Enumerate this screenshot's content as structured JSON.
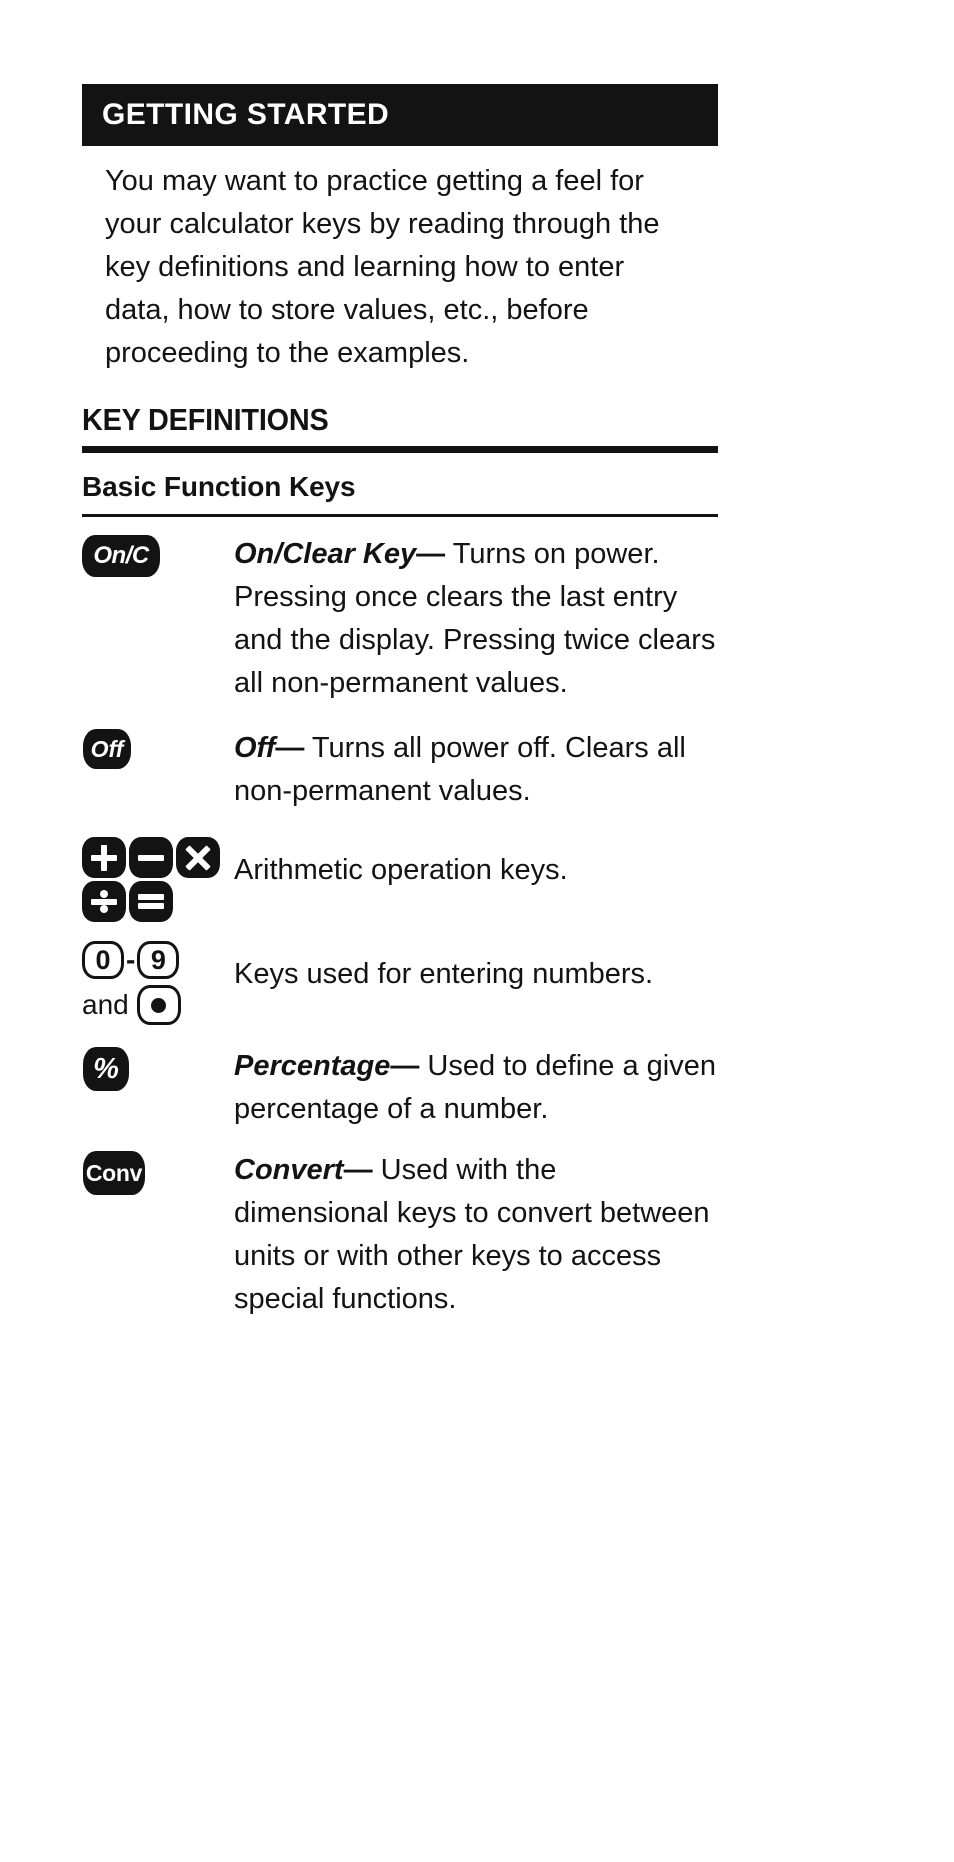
{
  "banner": {
    "title": "GETTING STARTED"
  },
  "intro": {
    "text": "You may want to practice getting a feel for your calculator keys by reading through the key definitions and learning how to enter data, how to store values, etc., before proceeding to the examples."
  },
  "key_definitions": {
    "heading": "KEY DEFINITIONS",
    "subheading": "Basic Function Keys",
    "rows": [
      {
        "key_label": "On/C",
        "key_icon": "on-clear-key-chip",
        "term": "On/Clear Key",
        "dash": "—",
        "definition": "Turns on power. Pressing once clears the last entry and the display. Pressing twice clears all non-permanent values."
      },
      {
        "key_label": "Off",
        "key_icon": "off-key-chip",
        "term": "Off",
        "dash": "—",
        "definition": "Turns all power off. Clears all non-permanent values."
      },
      {
        "key_label": "+ − × ÷ =",
        "key_icon": "arithmetic-keys-cluster",
        "term": "",
        "dash": "",
        "definition": "Arithmetic operation keys."
      },
      {
        "key_label": "0-9 and .",
        "key_icon": "number-keys-cluster",
        "term": "",
        "dash": "",
        "definition": "Keys used for entering numbers."
      },
      {
        "key_label": "%",
        "key_icon": "percent-key-chip",
        "term": "Percentage",
        "dash": "—",
        "definition": "Used to define a given percentage of a number."
      },
      {
        "key_label": "Conv",
        "key_icon": "convert-key-chip",
        "term": "Convert",
        "dash": "—",
        "definition": "Used with the dimensional keys to convert between units or with other keys to access special functions."
      }
    ],
    "number_keys": {
      "first": "0",
      "separator": "-",
      "last": "9",
      "and_label": "and",
      "decimal_point_icon": "decimal-point-key"
    }
  },
  "colors": {
    "ink": "#131313",
    "paper": "#ffffff"
  }
}
